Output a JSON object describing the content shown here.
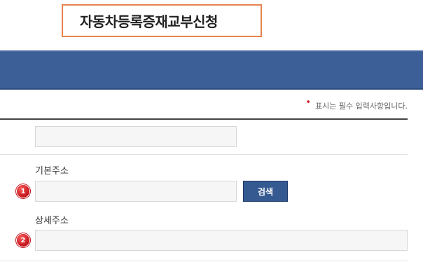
{
  "header": {
    "title": "자동차등록증재교부신청"
  },
  "form": {
    "required_marker": "•",
    "required_note": "표시는 필수 입력사항입니다.",
    "postal_code": {
      "value": "",
      "placeholder": ""
    },
    "basic_address": {
      "label": "기본주소",
      "badge": "1",
      "value": "",
      "placeholder": "",
      "search_button": "검색"
    },
    "detail_address": {
      "label": "상세주소",
      "badge": "2",
      "value": "",
      "placeholder": ""
    }
  },
  "colors": {
    "banner": "#3d5f98",
    "title_border": "#e8834e",
    "search_button": "#355a92",
    "badge": "#d4202b"
  }
}
